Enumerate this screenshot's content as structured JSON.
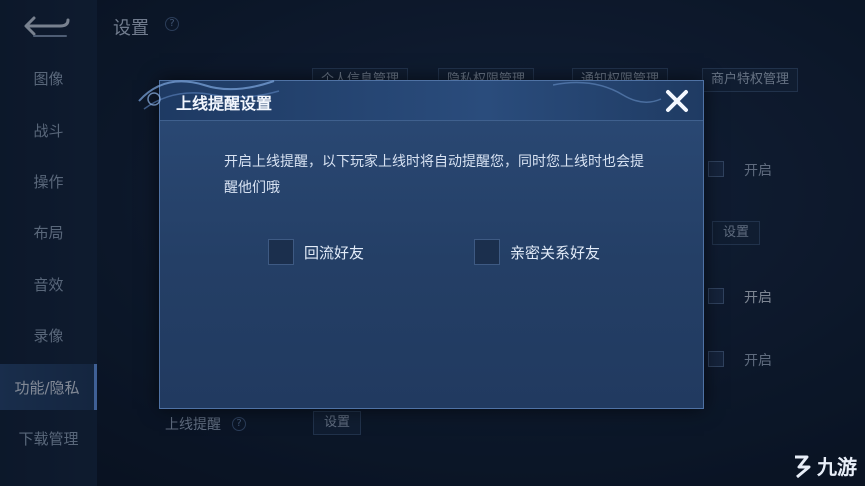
{
  "page": {
    "title": "设置"
  },
  "sidebar": {
    "items": [
      {
        "label": "图像"
      },
      {
        "label": "战斗"
      },
      {
        "label": "操作"
      },
      {
        "label": "布局"
      },
      {
        "label": "音效"
      },
      {
        "label": "录像"
      },
      {
        "label": "功能/隐私",
        "active": true
      },
      {
        "label": "下载管理"
      }
    ]
  },
  "tabs": [
    {
      "label": "个人信息管理"
    },
    {
      "label": "隐私权限管理"
    },
    {
      "label": "通知权限管理"
    },
    {
      "label": "商户特权管理"
    }
  ],
  "background": {
    "toggle_1": "开启",
    "settings_btn_1": "设置",
    "toggle_2": "开启",
    "toggle_3": "开启",
    "online_reminder_label": "上线提醒",
    "settings_btn_2": "设置"
  },
  "dialog": {
    "title": "上线提醒设置",
    "description": "开启上线提醒，以下玩家上线时将自动提醒您，同时您上线时也会提醒他们哦",
    "options": [
      {
        "label": "回流好友",
        "checked": false
      },
      {
        "label": "亲密关系好友",
        "checked": false
      }
    ]
  },
  "watermark": {
    "text": "九游"
  },
  "colors": {
    "accent": "#6fa6ff",
    "dialog_bg": "#2b4a76",
    "page_bg": "#0f1c30"
  }
}
